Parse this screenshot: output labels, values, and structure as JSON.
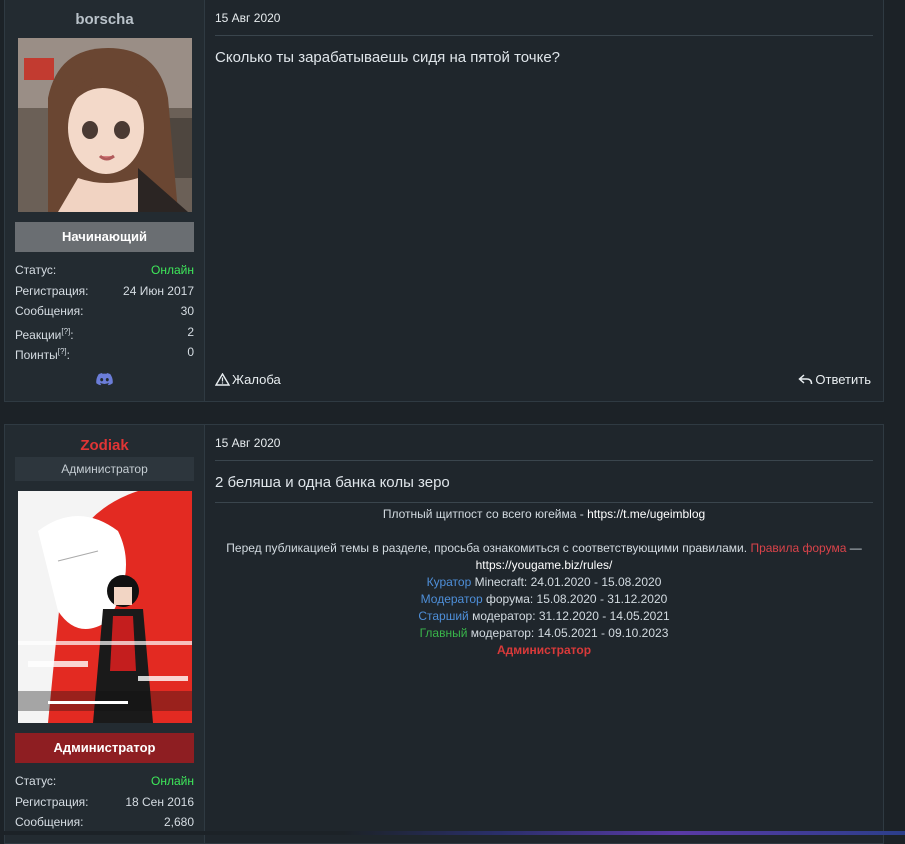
{
  "posts": [
    {
      "username": "borscha",
      "username_color": "#b9c2c9",
      "rank": "Начинающий",
      "rank_color": "#6a6e72",
      "stats": [
        {
          "label": "Статус:",
          "value": "Онлайн"
        },
        {
          "label": "Регистрация:",
          "value": "24 Июн 2017"
        },
        {
          "label": "Сообщения:",
          "value": "30"
        },
        {
          "label": "Реакции",
          "sup": "[?]",
          "suffix": ":",
          "value": "2"
        },
        {
          "label": "Поинты",
          "sup": "[?]",
          "suffix": ":",
          "value": "0"
        }
      ],
      "contact_icon": "discord-icon",
      "date": "15 Авг 2020",
      "message": "Сколько ты зарабатываешь сидя на пятой точке?",
      "report_label": "Жалоба",
      "reply_label": "Ответить"
    },
    {
      "username": "Zodiak",
      "username_color": "#e03535",
      "user_title": "Администратор",
      "rank": "Администратор",
      "rank_color": "#8e1e22",
      "stats": [
        {
          "label": "Статус:",
          "value": "Онлайн"
        },
        {
          "label": "Регистрация:",
          "value": "18 Сен 2016"
        },
        {
          "label": "Сообщения:",
          "value": "2,680"
        }
      ],
      "date": "15 Авг 2020",
      "message": "2 беляша и одна банка колы зеро",
      "signature": {
        "line1_text": "Плотный щитпост со всего югейма - ",
        "line1_link": "https://t.me/ugeimblog",
        "line2_text": "Перед публикацией темы в разделе, просьба ознакомиться с соответствующими правилами. ",
        "line2_link": "Правила форума",
        "line2_dash": " —",
        "line3_link": "https://yougame.biz/rules/",
        "roles": [
          {
            "role": "Куратор",
            "rest": " Minecraft: 24.01.2020 - 15.08.2020",
            "color": "bl"
          },
          {
            "role": "Модератор",
            "rest": " форума: 15.08.2020 - 31.12.2020",
            "color": "bl"
          },
          {
            "role": "Старший",
            "rest": " модератор: 31.12.2020 - 14.05.2021",
            "color": "bl"
          },
          {
            "role": "Главный",
            "rest": " модератор: 14.05.2021 - 09.10.2023",
            "color": "gr"
          }
        ],
        "last": "Администратор"
      }
    }
  ]
}
